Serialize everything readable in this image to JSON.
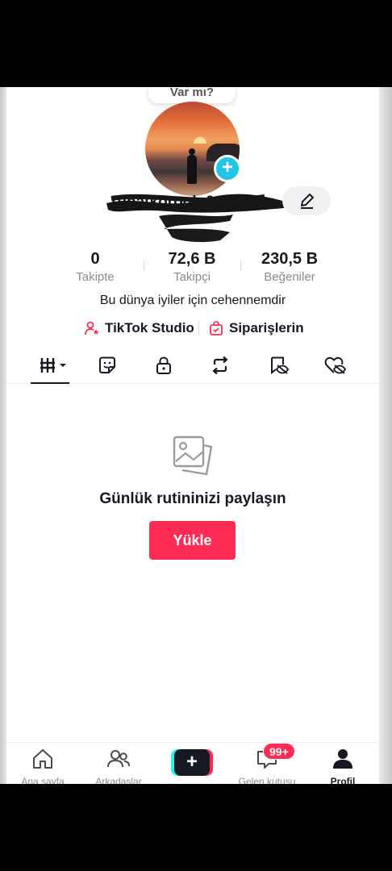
{
  "profile": {
    "bubble_text": "Var mı?",
    "username": "ruhatkoroglu0435",
    "stats": [
      {
        "value": "0",
        "label": "Takipte"
      },
      {
        "value": "72,6 B",
        "label": "Takipçi"
      },
      {
        "value": "230,5 B",
        "label": "Beğeniler"
      }
    ],
    "bio": "Bu dünya iyiler için cehennemdir",
    "links": {
      "studio": "TikTok Studio",
      "orders": "Siparişlerin"
    }
  },
  "tabs": [
    "videos-icon",
    "sticker-icon",
    "lock-icon",
    "repost-icon",
    "eye-hidden-icon",
    "heart-hidden-icon"
  ],
  "empty_state": {
    "title": "Günlük rutininizi paylaşın",
    "button": "Yükle"
  },
  "bottom_nav": {
    "home": "Ana sayfa",
    "friends": "Arkadaşlar",
    "inbox": "Gelen kutusu",
    "inbox_badge": "99+",
    "profile": "Profil"
  },
  "colors": {
    "accent": "#fe2c55",
    "cyan": "#25f4ee",
    "text": "#161823",
    "muted": "#8a8b91"
  }
}
